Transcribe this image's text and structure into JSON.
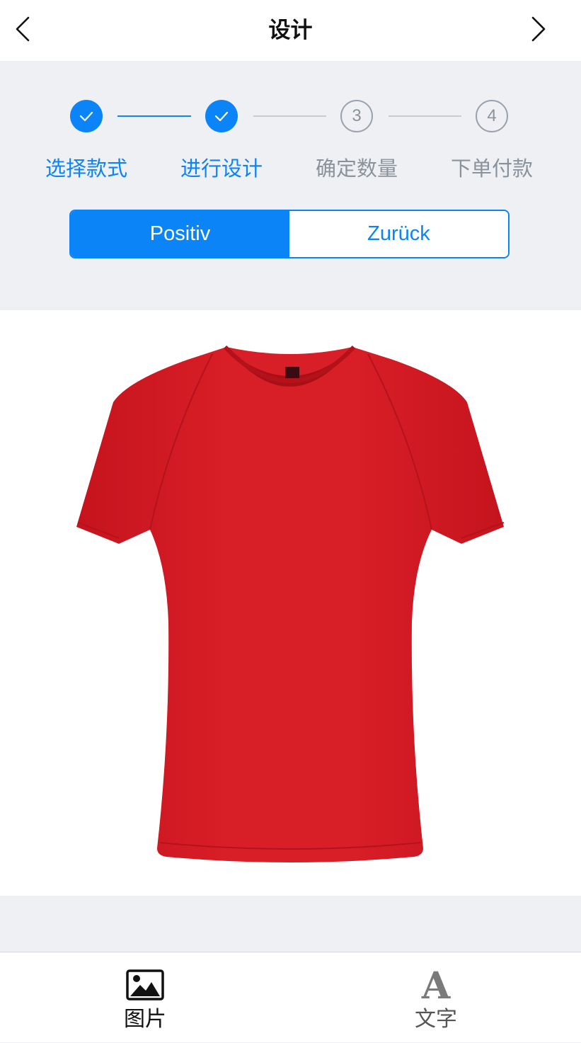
{
  "header": {
    "title": "设计",
    "back_icon": "chevron-left-icon",
    "forward_icon": "chevron-right-icon"
  },
  "steps": [
    {
      "number": "1",
      "label": "选择款式",
      "status": "done"
    },
    {
      "number": "2",
      "label": "进行设计",
      "status": "done"
    },
    {
      "number": "3",
      "label": "确定数量",
      "status": "todo"
    },
    {
      "number": "4",
      "label": "下单付款",
      "status": "todo"
    }
  ],
  "side_toggle": {
    "options": [
      "Positiv",
      "Zurück"
    ],
    "selected": "Positiv"
  },
  "canvas": {
    "garment": "red-tshirt",
    "garment_color": "#d21c24"
  },
  "toolbar": {
    "items": [
      {
        "label": "图片",
        "icon": "image-icon"
      },
      {
        "label": "文字",
        "icon": "text-icon"
      }
    ]
  },
  "colors": {
    "accent": "#0a84f6",
    "inactive": "#8a939c",
    "background": "#eef0f4"
  }
}
